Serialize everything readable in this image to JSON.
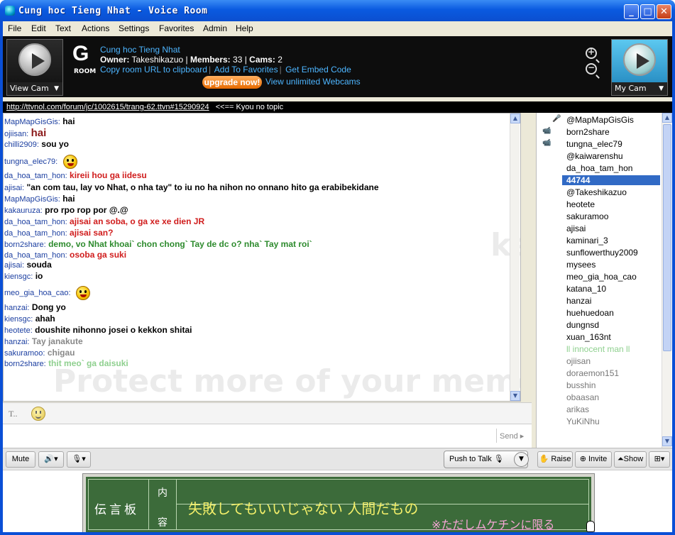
{
  "window": {
    "title": "Cung hoc Tieng Nhat - Voice Room"
  },
  "menu": [
    "File",
    "Edit",
    "Text",
    "Actions",
    "Settings",
    "Favorites",
    "Admin",
    "Help"
  ],
  "header": {
    "view_cam_label": "View Cam",
    "my_cam_label": "My Cam",
    "room_letter": "G",
    "room_word": "ROOM",
    "room_name": "Cung hoc Tieng Nhat",
    "owner_label": "Owner:",
    "owner": "Takeshikazuo",
    "members_label": "Members:",
    "members": "33",
    "cams_label": "Cams:",
    "cams": "2",
    "link_copy": "Copy room URL to clipboard",
    "link_fav": "Add To Favorites",
    "link_embed": "Get Embed Code",
    "upgrade": "upgrade now!",
    "unlimited": "View unlimited Webcams"
  },
  "topic": {
    "url": "http://ttvnol.com/forum/jc/1002615/trang-62.ttvn#15290924",
    "text": "<<== Kyou no topic"
  },
  "chat": [
    {
      "nick": "MapMapGisGis:",
      "msg": "hai",
      "color": "#000000",
      "big": false,
      "emo": false
    },
    {
      "nick": "ojiisan:",
      "msg": "hai",
      "color": "#8b1a1a",
      "big": true,
      "emo": false
    },
    {
      "nick": "chilli2909:",
      "msg": "sou yo",
      "color": "#000000",
      "big": false,
      "emo": false
    },
    {
      "nick": "tungna_elec79:",
      "msg": "",
      "color": "#000000",
      "big": false,
      "emo": true
    },
    {
      "nick": "da_hoa_tam_hon:",
      "msg": "kireii hou ga iidesu",
      "color": "#d01c1c",
      "big": false,
      "emo": false
    },
    {
      "nick": "ajisai:",
      "msg": "\"an com tau, lay vo Nhat, o nha tay\" to iu no ha nihon no onnano hito ga erabibekidane",
      "color": "#000000",
      "big": false,
      "emo": false
    },
    {
      "nick": "MapMapGisGis:",
      "msg": "hai",
      "color": "#000000",
      "big": false,
      "emo": false
    },
    {
      "nick": "kakauruza:",
      "msg": "pro rpo rop por @.@",
      "color": "#000000",
      "big": false,
      "emo": false
    },
    {
      "nick": "da_hoa_tam_hon:",
      "msg": "ajisai an soba, o ga xe xe dien JR",
      "color": "#d01c1c",
      "big": false,
      "emo": false
    },
    {
      "nick": "da_hoa_tam_hon:",
      "msg": "ajisai san?",
      "color": "#d01c1c",
      "big": false,
      "emo": false
    },
    {
      "nick": "born2share:",
      "msg": "demo, vo Nhat khoai` chon chong` Tay de dc o? nha` Tay mat roi`",
      "color": "#2e8b2e",
      "big": false,
      "emo": false
    },
    {
      "nick": "da_hoa_tam_hon:",
      "msg": "osoba ga suki",
      "color": "#d01c1c",
      "big": false,
      "emo": false
    },
    {
      "nick": "ajisai:",
      "msg": "souda",
      "color": "#000000",
      "big": false,
      "emo": false
    },
    {
      "nick": "kiensgc:",
      "msg": "io",
      "color": "#000000",
      "big": false,
      "emo": false
    },
    {
      "nick": "meo_gia_hoa_cao:",
      "msg": "",
      "color": "#000000",
      "big": false,
      "emo": true
    },
    {
      "nick": "hanzai:",
      "msg": "Dong yo",
      "color": "#000000",
      "big": false,
      "emo": false
    },
    {
      "nick": "kiensgc:",
      "msg": "ahah",
      "color": "#000000",
      "big": false,
      "emo": false
    },
    {
      "nick": "heotete:",
      "msg": "doushite nihonno josei o kekkon shitai",
      "color": "#000000",
      "big": false,
      "emo": false
    },
    {
      "nick": "hanzai:",
      "msg": "Tay janakute",
      "color": "#888888",
      "big": false,
      "emo": false
    },
    {
      "nick": "sakuramoo:",
      "msg": "chigau",
      "color": "#888888",
      "big": false,
      "emo": false
    },
    {
      "nick": "born2share:",
      "msg": "thit meo` ga daisuki",
      "color": "#8fd08f",
      "big": false,
      "emo": false
    }
  ],
  "input": {
    "font_btn": "T..",
    "send": "Send"
  },
  "controls": {
    "mute": "Mute",
    "ptt": "Push to Talk",
    "raise": "Raise",
    "invite": "Invite",
    "show": "Show"
  },
  "users": [
    {
      "name": "@MapMapGisGis",
      "icon": "mic-icon",
      "color": "#000000"
    },
    {
      "name": "born2share",
      "icon": "camera-icon",
      "color": "#000000"
    },
    {
      "name": "tungna_elec79",
      "icon": "camera-icon",
      "color": "#000000"
    },
    {
      "name": "@kaiwarenshu",
      "icon": "",
      "color": "#000000"
    },
    {
      "name": "da_hoa_tam_hon",
      "icon": "",
      "color": "#000000"
    },
    {
      "name": "44744",
      "icon": "",
      "color": "#ffffff"
    },
    {
      "name": "@Takeshikazuo",
      "icon": "",
      "color": "#000000"
    },
    {
      "name": "heotete",
      "icon": "",
      "color": "#000000"
    },
    {
      "name": "sakuramoo",
      "icon": "",
      "color": "#000000"
    },
    {
      "name": "ajisai",
      "icon": "",
      "color": "#000000"
    },
    {
      "name": "kaminari_3",
      "icon": "",
      "color": "#000000"
    },
    {
      "name": "sunflowerthuy2009",
      "icon": "",
      "color": "#000000"
    },
    {
      "name": "mysees",
      "icon": "",
      "color": "#000000"
    },
    {
      "name": "meo_gia_hoa_cao",
      "icon": "",
      "color": "#000000"
    },
    {
      "name": "katana_10",
      "icon": "",
      "color": "#000000"
    },
    {
      "name": "hanzai",
      "icon": "",
      "color": "#000000"
    },
    {
      "name": "huehuedoan",
      "icon": "",
      "color": "#000000"
    },
    {
      "name": "dungnsd",
      "icon": "",
      "color": "#000000"
    },
    {
      "name": "xuan_163nt",
      "icon": "",
      "color": "#000000"
    },
    {
      "name": "ll innocent man ll",
      "icon": "",
      "color": "#8fd08f"
    },
    {
      "name": "ojiisan",
      "icon": "",
      "color": "#777777"
    },
    {
      "name": "doraemon151",
      "icon": "",
      "color": "#777777"
    },
    {
      "name": "busshin",
      "icon": "",
      "color": "#777777"
    },
    {
      "name": "obaasan",
      "icon": "",
      "color": "#777777"
    },
    {
      "name": "arikas",
      "icon": "",
      "color": "#777777"
    },
    {
      "name": "YuKiNhu",
      "icon": "",
      "color": "#777777"
    }
  ],
  "board": {
    "title": "伝言板",
    "label_top": "内",
    "label_bottom": "容",
    "message": "失敗してもいいじゃない 人間だもの",
    "note": "※ただしムケチンに限る"
  },
  "watermark": {
    "big": "Protect more of your memories for less!",
    "side": "ke"
  }
}
